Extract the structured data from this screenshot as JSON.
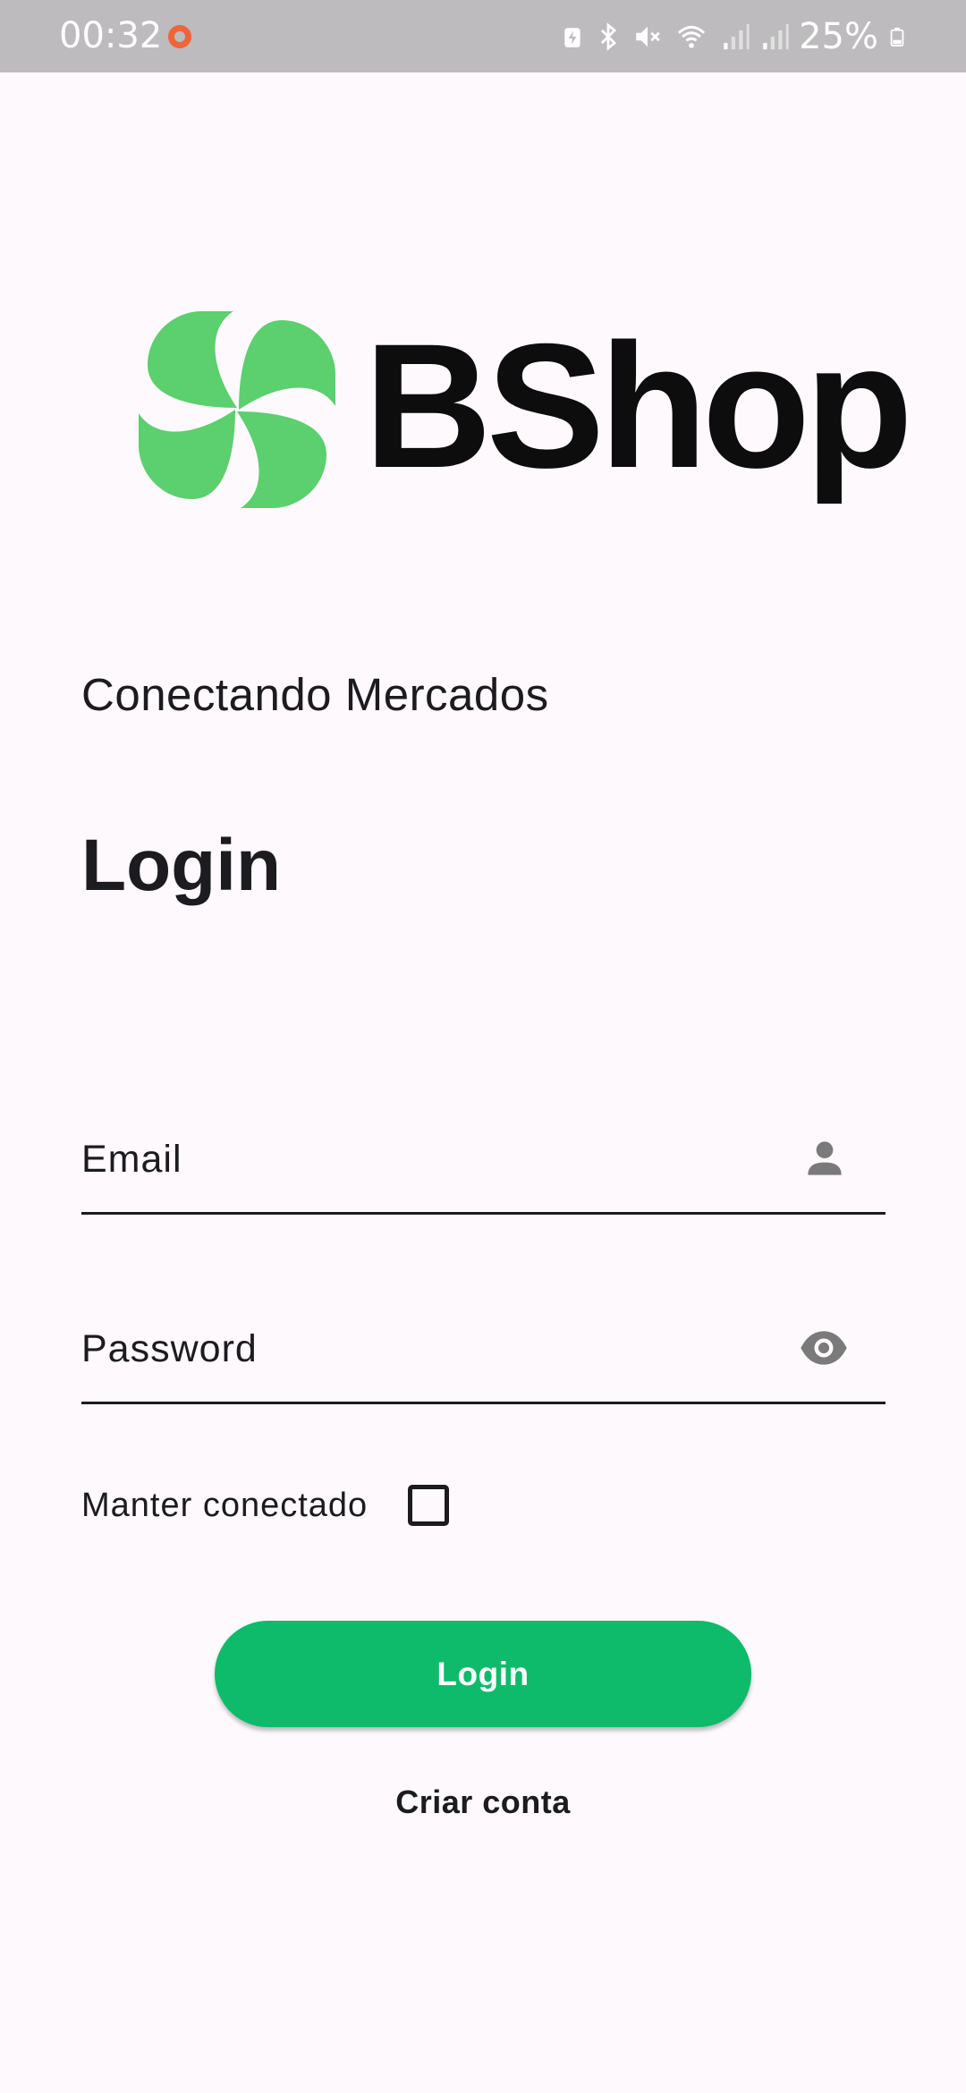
{
  "status_bar": {
    "time": "00:32",
    "battery": "25%",
    "icons": [
      "battery-saver-icon",
      "bluetooth-icon",
      "mute-icon",
      "wifi-icon",
      "signal-icon",
      "signal-icon",
      "battery-icon"
    ]
  },
  "brand": {
    "name": "BShop",
    "logo_color": "#5ccf6e",
    "tagline": "Conectando Mercados"
  },
  "login": {
    "title": "Login",
    "email_placeholder": "Email",
    "email_value": "",
    "email_icon": "person-icon",
    "password_placeholder": "Password",
    "password_value": "",
    "password_icon": "eye-icon",
    "keep_connected_label": "Manter conectado",
    "keep_connected_checked": false,
    "submit_label": "Login",
    "create_account_label": "Criar conta"
  },
  "colors": {
    "accent": "#0dbb6a",
    "background": "#fdf9fd",
    "status_bar": "#bdbbbd"
  }
}
